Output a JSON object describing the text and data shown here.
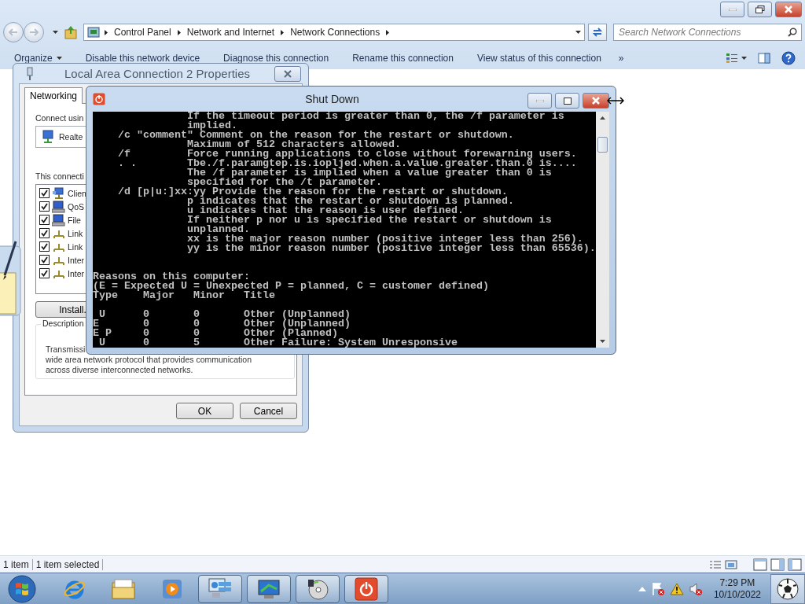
{
  "explorer": {
    "address": {
      "crumbs": [
        "Control Panel",
        "Network and Internet",
        "Network Connections"
      ]
    },
    "search": {
      "placeholder": "Search Network Connections"
    },
    "toolbar": [
      {
        "label": "Organize",
        "kind": "menu"
      },
      {
        "label": "Disable this network device",
        "kind": "command"
      },
      {
        "label": "Diagnose this connection",
        "kind": "command"
      },
      {
        "label": "Rename this connection",
        "kind": "command"
      },
      {
        "label": "View status of this connection",
        "kind": "command"
      },
      {
        "label": "»",
        "kind": "overflow"
      }
    ],
    "status_bar": [
      "1 item",
      "1 item selected"
    ]
  },
  "properties_dialog": {
    "title": "Local Area Connection 2 Properties",
    "tabs": [
      {
        "label": "Networking",
        "selected": true
      }
    ],
    "connect_using_label": "Connect usin",
    "adapter": "Realte",
    "items_label": "This connecti",
    "items": [
      {
        "label": "Clien",
        "checked": true,
        "kind": "client"
      },
      {
        "label": "QoS",
        "checked": true,
        "kind": "service"
      },
      {
        "label": "File",
        "checked": true,
        "kind": "service"
      },
      {
        "label": "Link",
        "checked": true,
        "kind": "protocol"
      },
      {
        "label": "Link",
        "checked": true,
        "kind": "protocol"
      },
      {
        "label": "Inter",
        "checked": true,
        "kind": "protocol"
      },
      {
        "label": "Inter",
        "checked": true,
        "kind": "protocol"
      }
    ],
    "install_button": "Install.",
    "description": {
      "label": "Description",
      "lines": [
        "Transmissi",
        "wide area network protocol that provides communication",
        "across diverse interconnected networks."
      ]
    },
    "buttons": [
      "OK",
      "Cancel"
    ]
  },
  "console": {
    "title": "Shut Down",
    "help_lines": [
      {
        "kind": "continuation",
        "text": "If the timeout period is greater than 0, the /f parameter is"
      },
      {
        "kind": "continuation",
        "text": "implied."
      },
      {
        "kind": "option",
        "option": "/c \"comment\"",
        "text": "Comment on the reason for the restart or shutdown."
      },
      {
        "kind": "continuation",
        "text": "Maximum of 512 characters allowed."
      },
      {
        "kind": "option",
        "option": "/f",
        "text": "Force running applications to close without forewarning users."
      },
      {
        "kind": "option",
        "option": ". .",
        "text": "Tbe./f.paramgtep.is.iopljed.when.a.value.greater.than.0 is...."
      },
      {
        "kind": "continuation",
        "text": "The /f parameter is implied when a value greater than 0 is"
      },
      {
        "kind": "continuation",
        "text": "specified for the /t parameter."
      },
      {
        "kind": "option",
        "option": "/d [p|u:]xx:yy",
        "text": "Provide the reason for the restart or shutdown."
      },
      {
        "kind": "continuation",
        "text": "p indicates that the restart or shutdown is planned."
      },
      {
        "kind": "continuation",
        "text": "u indicates that the reason is user defined."
      },
      {
        "kind": "continuation",
        "text": "If neither p nor u is specified the restart or shutdown is"
      },
      {
        "kind": "continuation",
        "text": "unplanned."
      },
      {
        "kind": "continuation",
        "text": "xx is the major reason number (positive integer less than 256)."
      },
      {
        "kind": "continuation",
        "text": "yy is the minor reason number (positive integer less than 65536)."
      }
    ],
    "reasons_heading": "Reasons on this computer:",
    "legend": "(E = Expected U = Unexpected P = planned, C = customer defined)",
    "table": {
      "columns": [
        "Type",
        "Major",
        "Minor",
        "Title"
      ],
      "rows": [
        [
          " U",
          "0",
          "0",
          "Other (Unplanned)"
        ],
        [
          "E",
          "0",
          "0",
          "Other (Unplanned)"
        ],
        [
          "E P",
          "0",
          "0",
          "Other (Planned)"
        ],
        [
          " U",
          "0",
          "5",
          "Other Failure: System Unresponsive"
        ]
      ]
    }
  },
  "taskbar": {
    "clock": {
      "time": "7:29 PM",
      "date": "10/10/2022"
    }
  }
}
